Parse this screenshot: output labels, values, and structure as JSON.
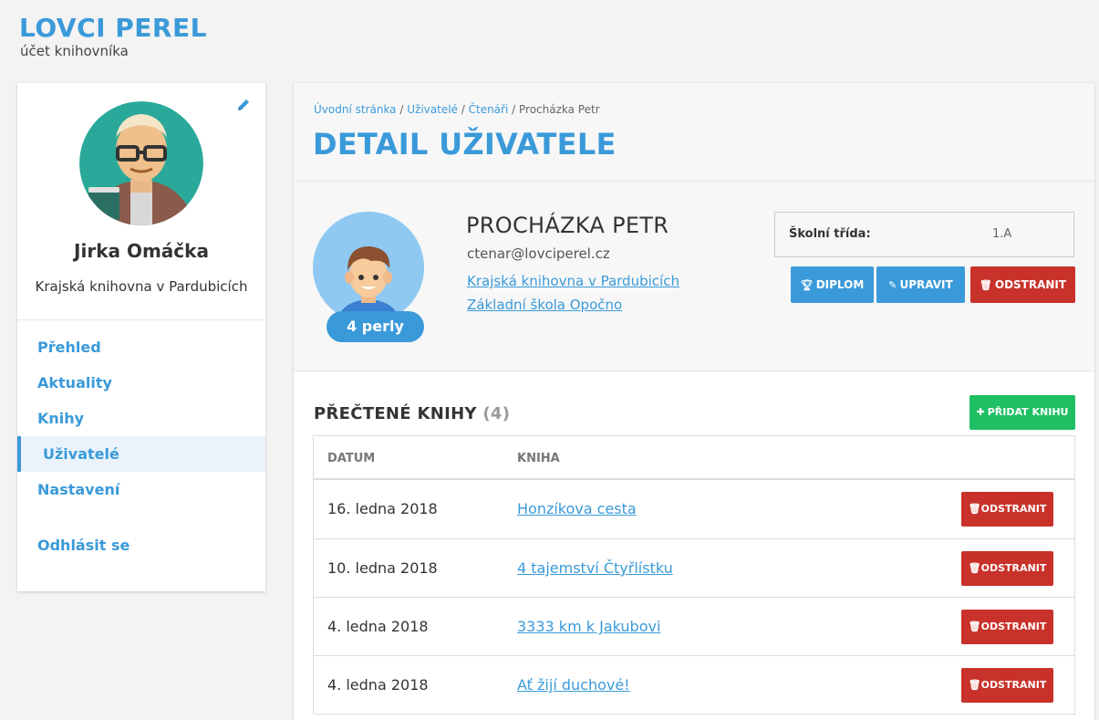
{
  "brand": {
    "title": "LOVCI PEREL",
    "subtitle": "účet knihovníka"
  },
  "sidebar": {
    "user_name": "Jirka Omáčka",
    "library": "Krajská knihovna v Pardubicích",
    "nav": [
      {
        "label": "Přehled"
      },
      {
        "label": "Aktuality"
      },
      {
        "label": "Knihy"
      },
      {
        "label": "Uživatelé"
      },
      {
        "label": "Nastavení"
      }
    ],
    "logout": "Odhlásit se"
  },
  "breadcrumb": {
    "home": "Úvodní stránka",
    "users": "Uživatelé",
    "readers": "Čtenáři",
    "current": "Procházka Petr"
  },
  "page_title": "DETAIL UŽIVATELE",
  "profile": {
    "name": "PROCHÁZKA PETR",
    "email": "ctenar@lovciperel.cz",
    "library_link": "Krajská knihovna v Pardubicích",
    "school_link": "Základní škola Opočno",
    "pearls": "4 perly",
    "class_label": "Školní třída:",
    "class_value": "1.A"
  },
  "actions": {
    "diploma": "DIPLOM",
    "edit": "UPRAVIT",
    "remove": "ODSTRANIT"
  },
  "books": {
    "title": "PŘEČTENÉ KNIHY",
    "count": "(4)",
    "add_label": "PŘIDAT KNIHU",
    "col_date": "DATUM",
    "col_book": "KNIHA",
    "remove_label": "ODSTRANIT",
    "rows": [
      {
        "date": "16. ledna 2018",
        "book": "Honzíkova cesta"
      },
      {
        "date": "10. ledna 2018",
        "book": "4 tajemství Čtyřlístku"
      },
      {
        "date": "4. ledna 2018",
        "book": "3333 km k Jakubovi"
      },
      {
        "date": "4. ledna 2018",
        "book": "Ať žijí duchové!"
      }
    ]
  },
  "colors": {
    "accent": "#3a9ad9",
    "danger": "#c8322a",
    "success": "#1fbf63"
  },
  "icons": [
    "pencil-icon",
    "trophy-icon",
    "edit-icon",
    "trash-icon",
    "plus-icon"
  ]
}
